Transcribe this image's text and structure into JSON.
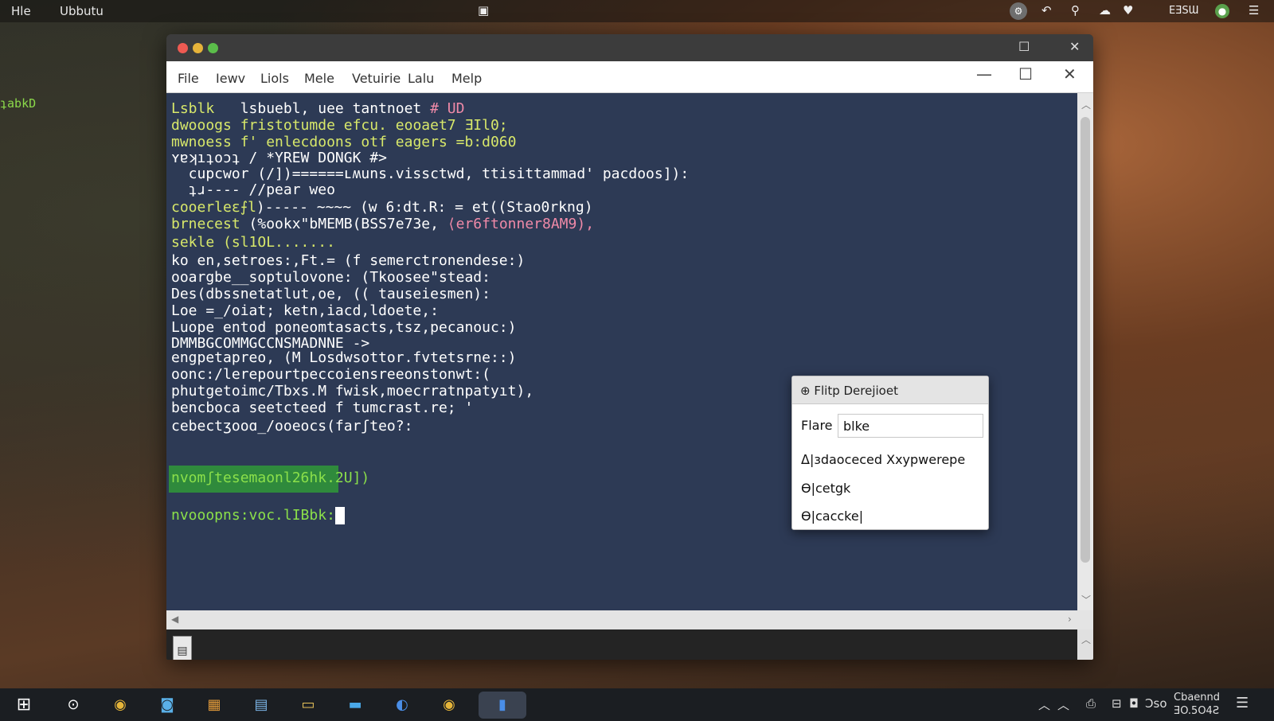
{
  "top_panel": {
    "left_item": "Hle",
    "app_name": "Ubbutu",
    "tray_text": "EƎSƜ"
  },
  "side_prompt": "ʇabkD",
  "window": {
    "menu": [
      "File",
      "Iewv",
      "Liols",
      "Mele",
      "Vetuirie",
      "Lalu",
      "Melp"
    ]
  },
  "terminal": {
    "lines": [
      [
        {
          "t": "Lsblk",
          "c": "y"
        },
        {
          "t": "   lsbuebl, uee tantnoet ",
          "c": "w"
        },
        {
          "t": "# UD",
          "c": "p"
        }
      ],
      [
        {
          "t": "dwooogs ",
          "c": "y"
        },
        {
          "t": "fristotumde efcu. eooaet7 ƎIl0;",
          "c": "y"
        }
      ],
      [
        {
          "t": "mwnoess ",
          "c": "y"
        },
        {
          "t": "f' enlecdoons otf eagers =b:d060",
          "c": "y"
        }
      ],
      [
        {
          "t": "ʏɐʞıʇoɔʇ / *YREW DONGK #>",
          "c": "w"
        }
      ],
      [
        {
          "t": "  cupcwor (/])======ʟʍuns.vissctwd, ttisittammad' pacdoos]):",
          "c": "w"
        }
      ],
      [
        {
          "t": "  ʇɹ---- //pear weo",
          "c": "w"
        }
      ],
      [
        {
          "t": "cooerleɛ⨍l",
          "c": "y"
        },
        {
          "t": ")----- ~~~~ (w 6:dt.R: = et((Stao0rkng)",
          "c": "w"
        }
      ],
      [
        {
          "t": "brnecest",
          "c": "y"
        },
        {
          "t": " (%ookx\"bMEMB(BSS7e73e, ",
          "c": "w"
        },
        {
          "t": "⟨er6ftonner8AM9),",
          "c": "p"
        }
      ],
      [
        {
          "t": "sekle (sl1OL.......",
          "c": "y"
        }
      ],
      [
        {
          "t": "ko en,setroes:,Ft.= (f semerctronendese:)",
          "c": "w"
        }
      ],
      [
        {
          "t": "ooargbe__soptulovone: (Tkoosee\"stead:",
          "c": "w"
        }
      ],
      [
        {
          "t": "Des(dbssnetatlut,oe, (( tauseiesmen):",
          "c": "w"
        }
      ],
      [
        {
          "t": "Loe =_/oiat; ketn,iacd,ldoete,:",
          "c": "w"
        }
      ],
      [
        {
          "t": "Luope entod poneomtasacts,tsz,pecanouc:)",
          "c": "w"
        }
      ],
      [
        {
          "t": "DMMBGCOMMGCCNSMADNNE ->",
          "c": "w"
        }
      ],
      [
        {
          "t": "engpetapreo, (M Losdwsottor.fvtetsrne::)",
          "c": "w"
        }
      ],
      [
        {
          "t": "oonc:/lerepourtpeccoiensreeonstonwt:(",
          "c": "w"
        }
      ],
      [
        {
          "t": "phutgetoimc/Tbxs.M fwisk,moecrratnpatyıt),",
          "c": "w"
        }
      ],
      [
        {
          "t": "bencboca seetcteed f tumcrast.re; '",
          "c": "w"
        }
      ],
      [
        {
          "t": "cebectʒooɑ_/ooeocs(farʃteo?:",
          "c": "w"
        }
      ]
    ],
    "highlight_line": "nvomʃtesemaonl26hk.2U])",
    "prompt_line": "nvooopns:voc.lIBbk:"
  },
  "dialog": {
    "title": "Flitp Derejioet",
    "field_label": "Flare",
    "field_value": "blke",
    "options": [
      "ᐃ|ɜdaoceced Xxypwerepe",
      "Ɵ|cetgk",
      "Ɵ|caccke|"
    ]
  },
  "taskbar": {
    "clock_line1": "Cbaennd",
    "clock_line2": "ƎO.5O4Ƨ",
    "tray_text": "Ɔso"
  }
}
